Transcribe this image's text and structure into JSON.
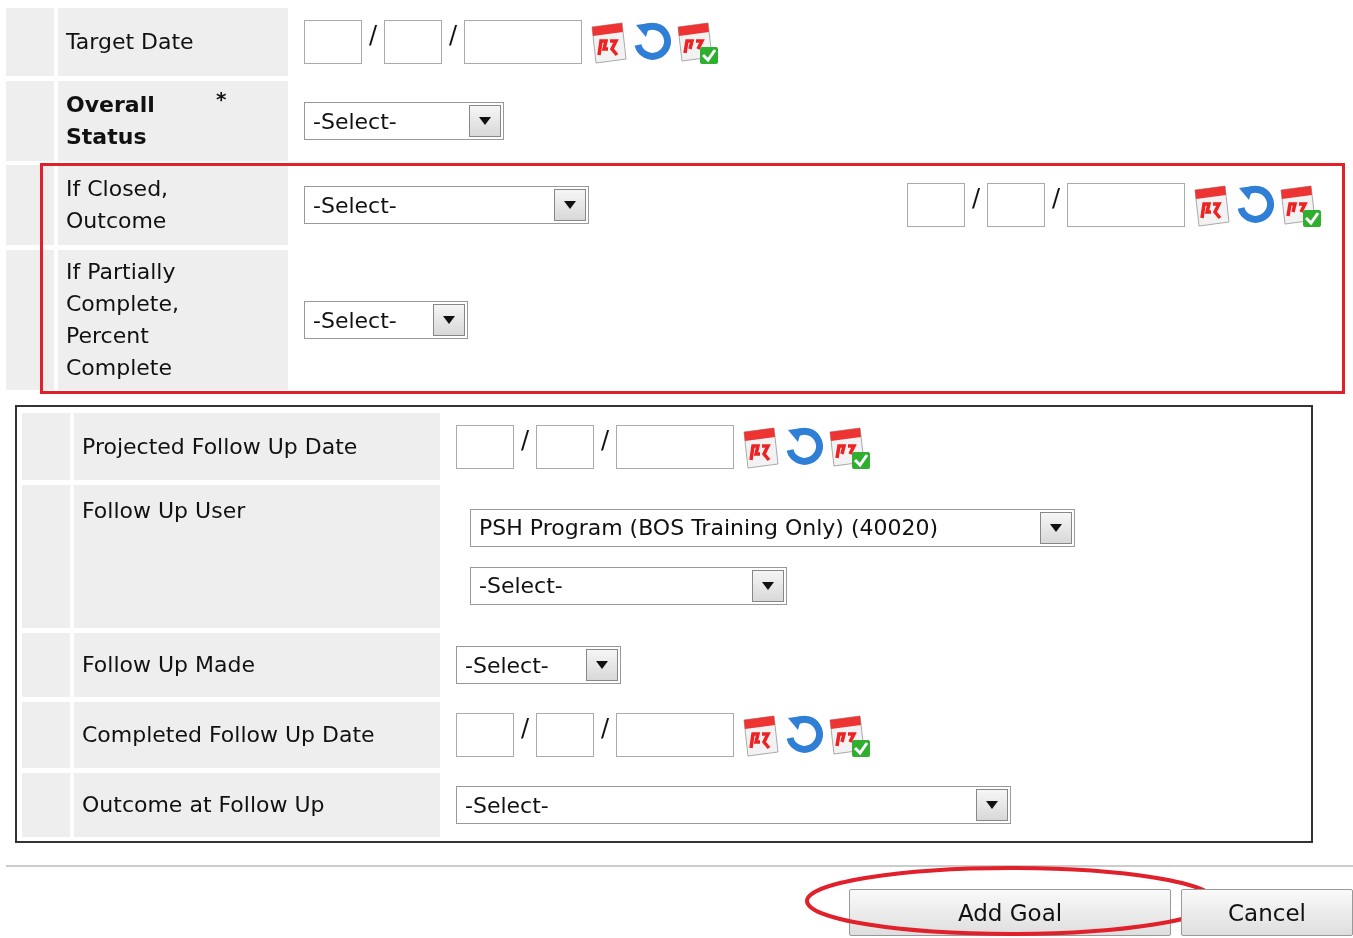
{
  "sections": [
    {
      "rows": [
        {
          "label": "Target Date",
          "controls": [
            {
              "kind": "date",
              "separators": [
                "/",
                "/"
              ]
            }
          ]
        },
        {
          "label": "Overall Status",
          "required_mark": "*",
          "controls": [
            {
              "kind": "select",
              "value": "-Select-"
            }
          ]
        }
      ]
    },
    {
      "highlighted": true,
      "rows": [
        {
          "label": "If Closed, Outcome",
          "controls": [
            {
              "kind": "select",
              "value": "-Select-"
            },
            {
              "kind": "date",
              "separators": [
                "/",
                "/"
              ]
            }
          ]
        },
        {
          "label": "If Partially Complete, Percent Complete",
          "controls": [
            {
              "kind": "select",
              "value": "-Select-"
            }
          ]
        }
      ]
    }
  ],
  "follow_up_panel": {
    "rows": [
      {
        "label": "Projected Follow Up Date",
        "controls": [
          {
            "kind": "date",
            "separators": [
              "/",
              "/"
            ]
          }
        ]
      },
      {
        "label": "Follow Up User",
        "controls": [
          {
            "kind": "select",
            "value": "PSH Program (BOS Training Only) (40020)"
          },
          {
            "kind": "select",
            "value": "-Select-"
          }
        ]
      },
      {
        "label": "Follow Up Made",
        "controls": [
          {
            "kind": "select",
            "value": "-Select-"
          }
        ]
      },
      {
        "label": "Completed Follow Up Date",
        "controls": [
          {
            "kind": "date",
            "separators": [
              "/",
              "/"
            ]
          }
        ]
      },
      {
        "label": "Outcome at Follow Up",
        "controls": [
          {
            "kind": "select",
            "value": "-Select-"
          }
        ]
      }
    ]
  },
  "buttons": [
    {
      "label": "Add Goal",
      "circled": true
    },
    {
      "label": "Cancel"
    }
  ]
}
